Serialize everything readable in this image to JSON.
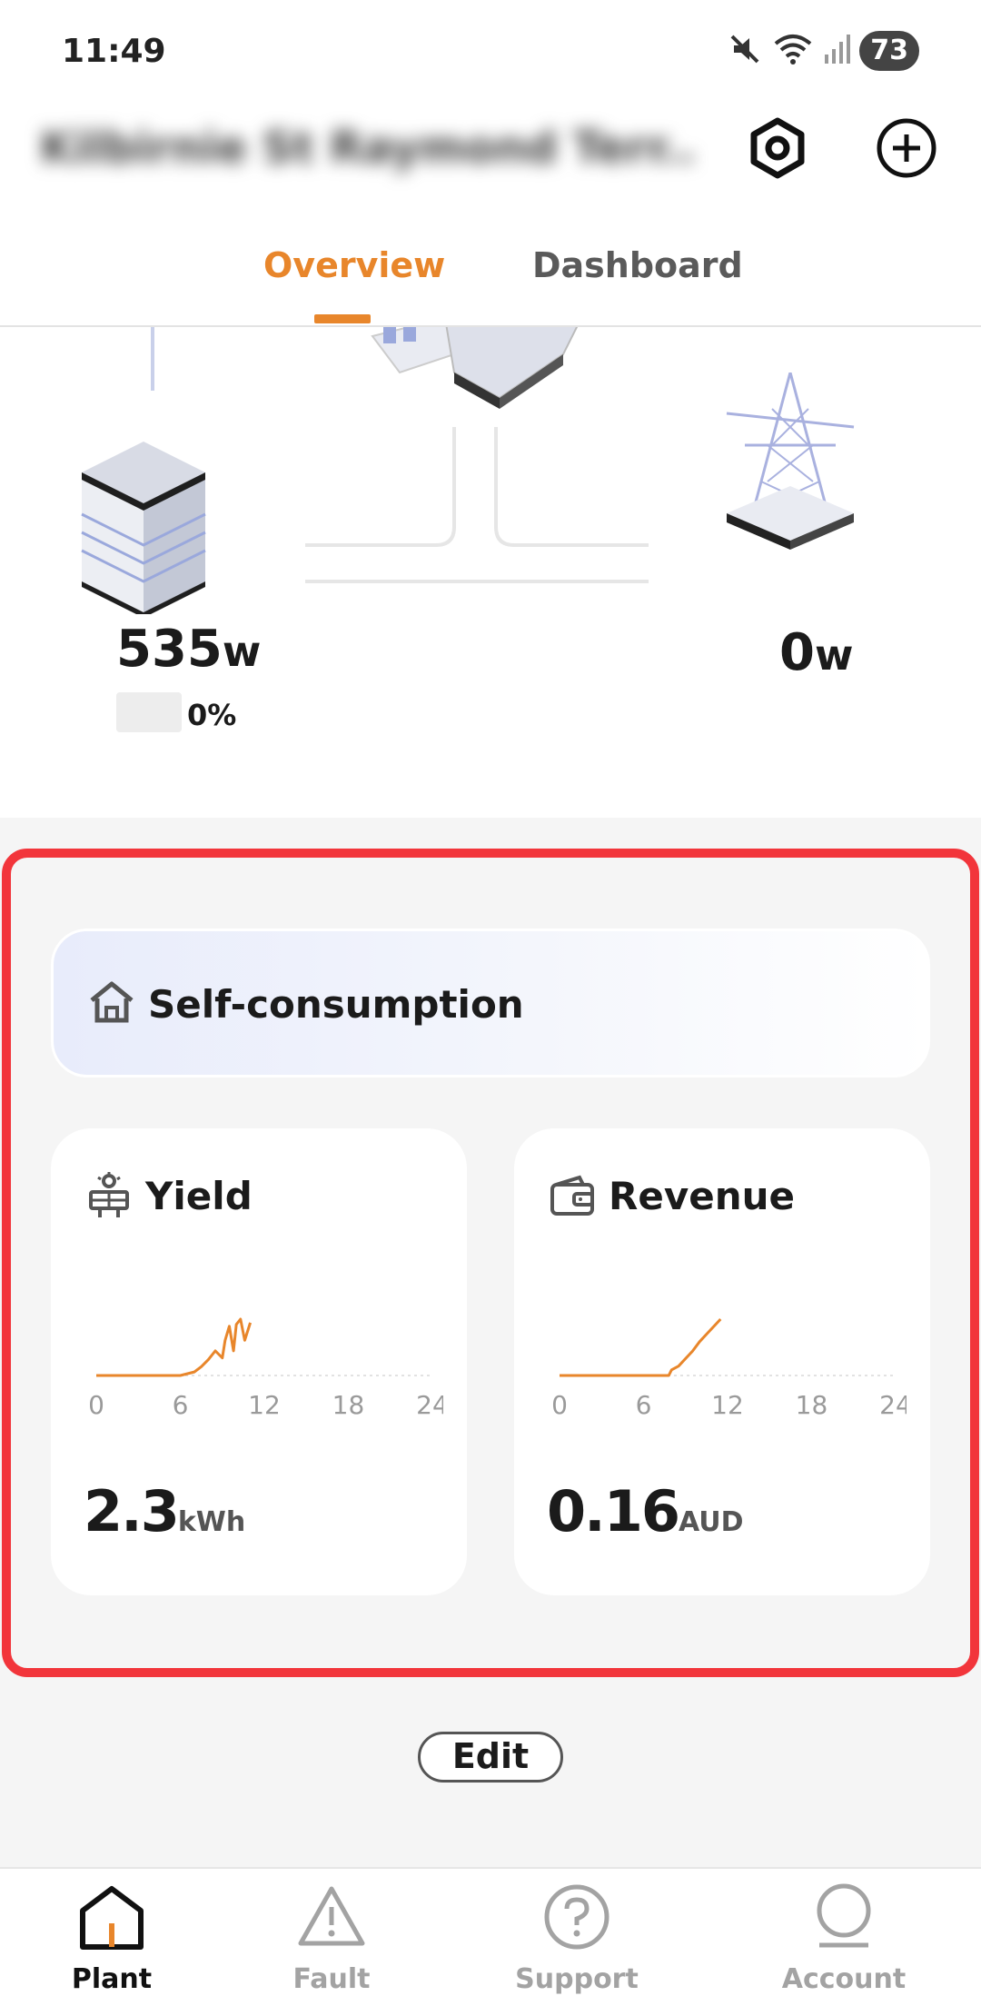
{
  "status_bar": {
    "time": "11:49",
    "battery": "73"
  },
  "header": {
    "plant_name": "Kilbirnie St Raymond Terr..."
  },
  "tabs": [
    {
      "label": "Overview"
    },
    {
      "label": "Dashboard"
    }
  ],
  "flow": {
    "battery_power": "535",
    "battery_unit": "w",
    "battery_soc": "0%",
    "grid_power": "0",
    "grid_unit": "w"
  },
  "self_consumption": {
    "title": "Self-consumption"
  },
  "yield_card": {
    "title": "Yield",
    "value": "2.3",
    "unit": "kWh",
    "axis_ticks": [
      "0",
      "6",
      "12",
      "18",
      "24"
    ]
  },
  "revenue_card": {
    "title": "Revenue",
    "value": "0.16",
    "unit": "AUD",
    "axis_ticks": [
      "0",
      "6",
      "12",
      "18",
      "24"
    ]
  },
  "edit_button": {
    "label": "Edit"
  },
  "bottom_nav": [
    {
      "label": "Plant"
    },
    {
      "label": "Fault"
    },
    {
      "label": "Support"
    },
    {
      "label": "Account"
    }
  ],
  "colors": {
    "accent": "#e8862b",
    "highlight": "#f2353b",
    "inactive": "#a3a3a3"
  },
  "chart_data": [
    {
      "type": "line",
      "title": "Yield",
      "x": [
        0,
        6,
        7,
        7.5,
        8,
        8.5,
        9,
        9.2,
        9.5,
        9.8,
        10,
        10.3,
        10.6,
        11
      ],
      "y": [
        0,
        0,
        0.2,
        0.5,
        0.9,
        1.4,
        1.0,
        2.0,
        2.8,
        1.4,
        2.9,
        3.2,
        2.0,
        3.0
      ],
      "xlim": [
        0,
        24
      ],
      "xticks": [
        "0",
        "6",
        "12",
        "18",
        "24"
      ],
      "grid": false
    },
    {
      "type": "line",
      "title": "Revenue",
      "x": [
        0,
        7.8,
        8,
        8.5,
        9,
        9.5,
        10,
        10.5,
        11,
        11.5
      ],
      "y": [
        0,
        0,
        0.3,
        0.5,
        0.9,
        1.3,
        1.8,
        2.2,
        2.6,
        3.0
      ],
      "xlim": [
        0,
        24
      ],
      "xticks": [
        "0",
        "6",
        "12",
        "18",
        "24"
      ],
      "grid": false
    }
  ]
}
